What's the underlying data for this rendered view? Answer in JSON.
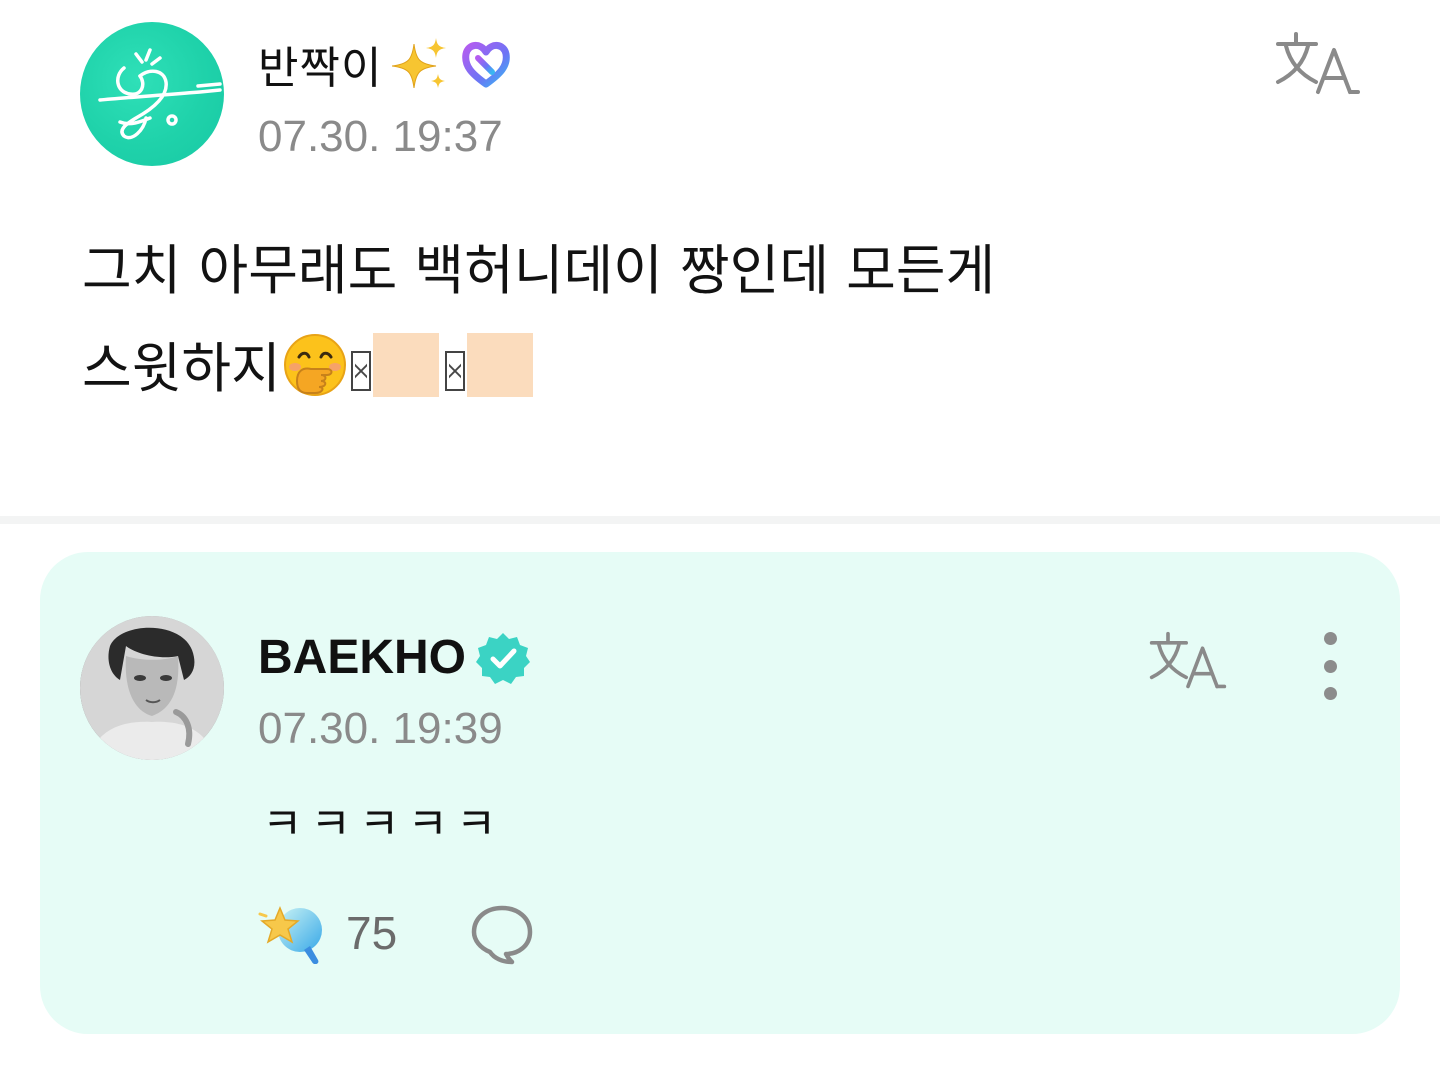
{
  "fan_post": {
    "username": "반짝이",
    "timestamp": "07.30. 19:37",
    "body_line1": "그치 아무래도 백허니데이 짱인데 모든게",
    "body_line2": "스윗하지"
  },
  "artist_reply": {
    "username": "BAEKHO",
    "timestamp": "07.30. 19:39",
    "text": "ㅋㅋㅋㅋㅋ",
    "like_count": "75"
  },
  "colors": {
    "reply_bg": "#e6fcf6",
    "verified": "#3bd3c4",
    "fan_avatar": "#1fd2aa",
    "membership_badge": "#7a6cf0"
  },
  "icons": {
    "sparkles": "sparkles-icon",
    "membership": "membership-heart-icon",
    "verified": "verified-badge-icon",
    "translate": "translate-icon",
    "more": "more-vertical-icon",
    "like": "star-wand-icon",
    "comment": "comment-bubble-icon"
  }
}
